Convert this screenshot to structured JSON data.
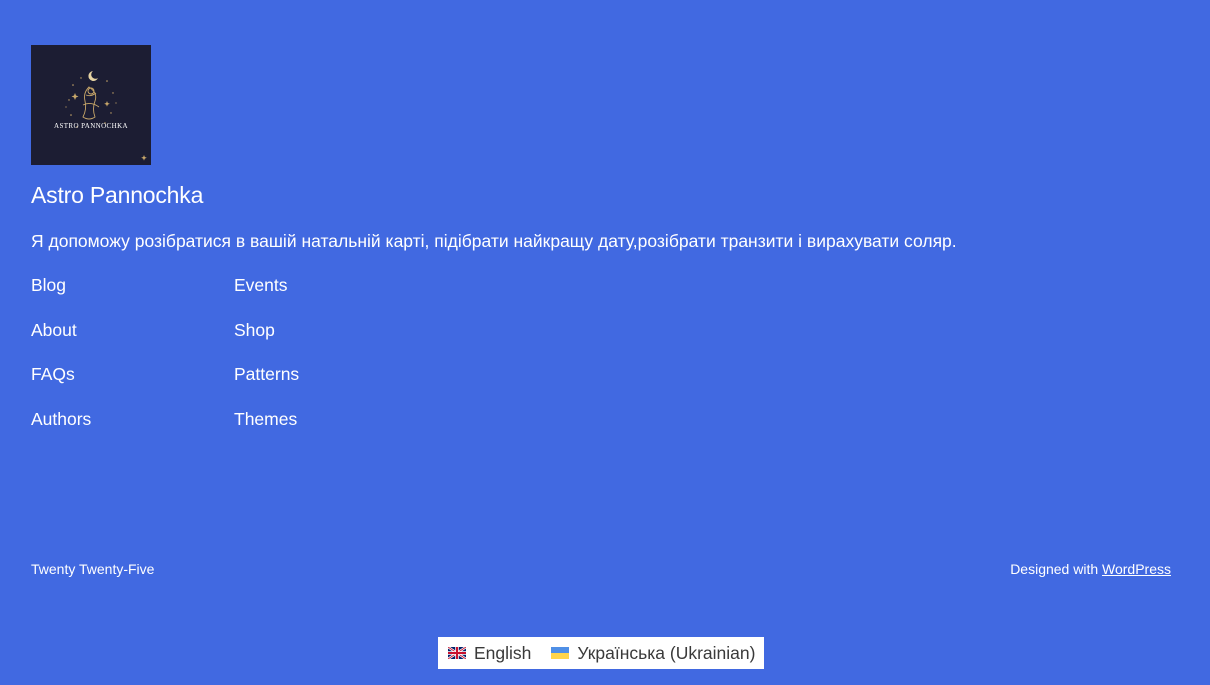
{
  "site": {
    "logo_text": "ASTRO PANNOCHKA",
    "title": "Astro Pannochka",
    "tagline": "Я допоможу розібратися в вашій натальній карті, підібрати найкращу дату,розібрати транзити і вирахувати соляр."
  },
  "nav": {
    "column1": [
      {
        "label": "Blog"
      },
      {
        "label": "About"
      },
      {
        "label": "FAQs"
      },
      {
        "label": "Authors"
      }
    ],
    "column2": [
      {
        "label": "Events"
      },
      {
        "label": "Shop"
      },
      {
        "label": "Patterns"
      },
      {
        "label": "Themes"
      }
    ]
  },
  "footer": {
    "theme_name": "Twenty Twenty-Five",
    "designed_with_prefix": "Designed with",
    "designed_with_link": "WordPress"
  },
  "language_switcher": {
    "items": [
      {
        "label": "English",
        "flag": "uk-flag-icon"
      },
      {
        "label": "Українська (Ukrainian)",
        "flag": "ukraine-flag-icon"
      }
    ]
  },
  "colors": {
    "background": "#4169e1",
    "text": "#ffffff",
    "logo_background": "#1c1d33",
    "logo_gold": "#c9a86a"
  }
}
